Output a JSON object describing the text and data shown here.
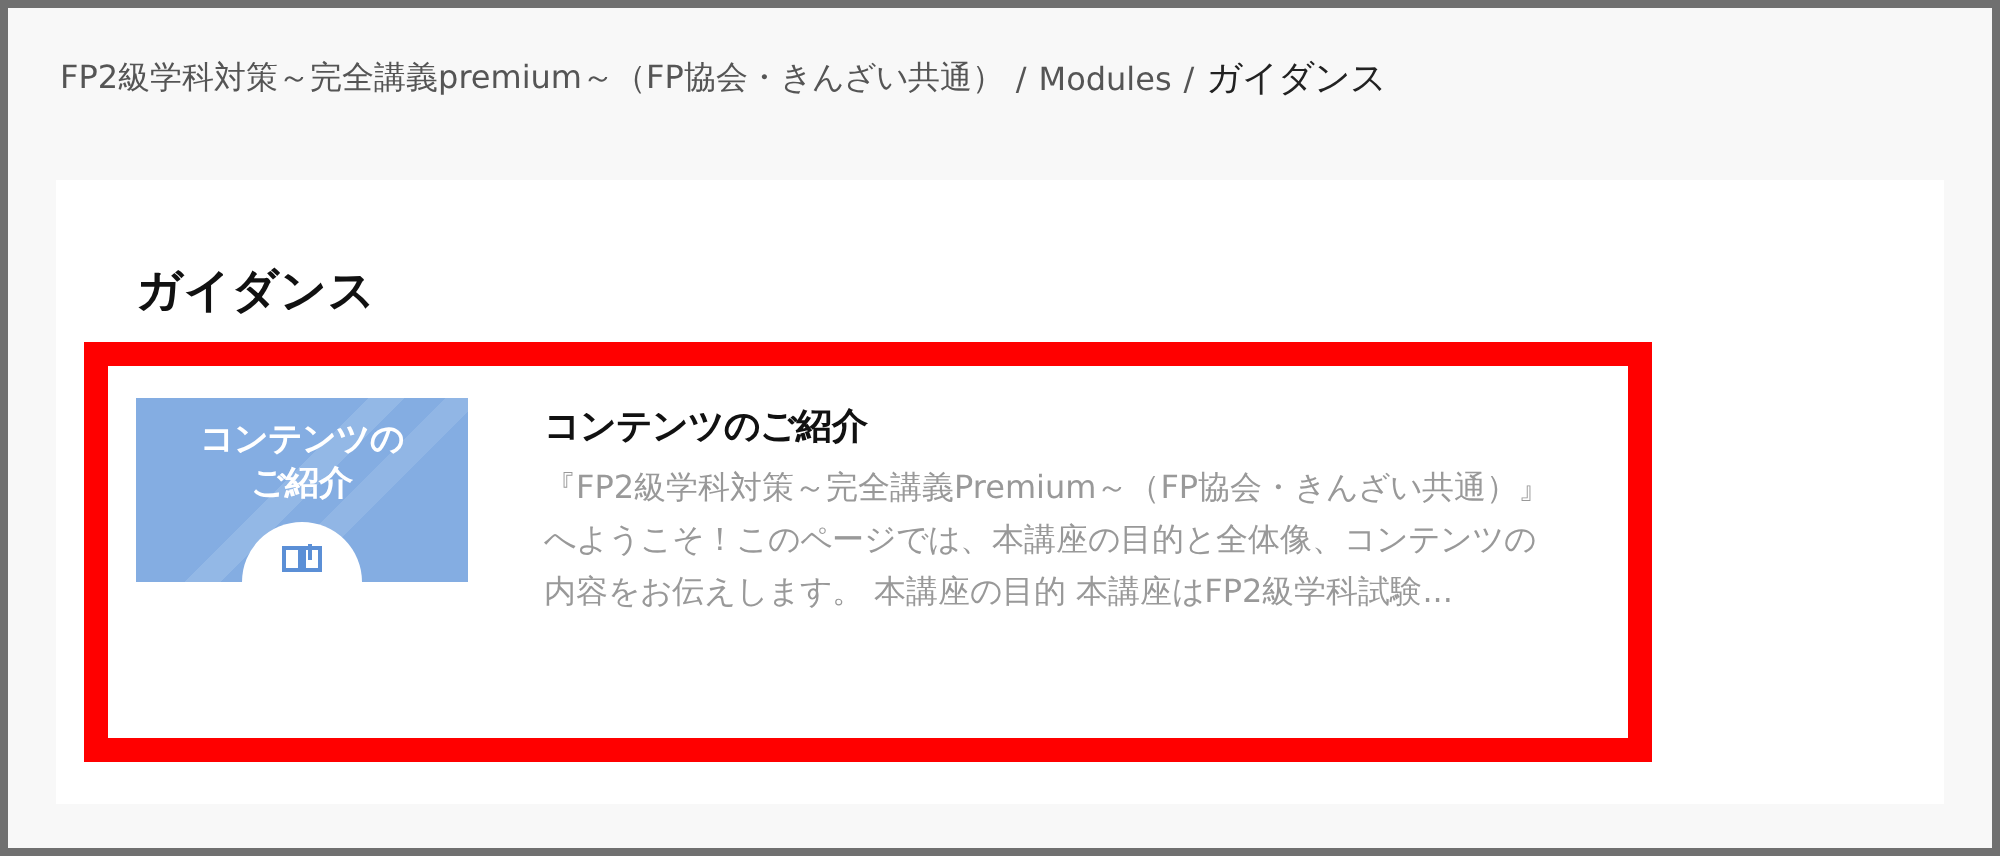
{
  "breadcrumb": [
    {
      "kind": "link",
      "label": "FP2級学科対策～完全講義premium～（FP協会・きんざい共通）"
    },
    {
      "kind": "separator",
      "label": "/"
    },
    {
      "kind": "link",
      "label": "Modules"
    },
    {
      "kind": "separator",
      "label": "/"
    },
    {
      "kind": "current",
      "label": "ガイダンス"
    }
  ],
  "module": {
    "title": "ガイダンス",
    "items": [
      {
        "highlighted": true,
        "thumbnail": {
          "lines": [
            "コンテンツの",
            "ご紹介"
          ]
        },
        "title": "コンテンツのご紹介",
        "description": "『FP2級学科対策～完全講義Premium～（FP協会・きんざい共通）』へようこそ！このページでは、本講座の目的と全体像、コンテンツの内容をお伝えします。 本講座の目的 本講座はFP2級学科試験..."
      }
    ]
  }
}
